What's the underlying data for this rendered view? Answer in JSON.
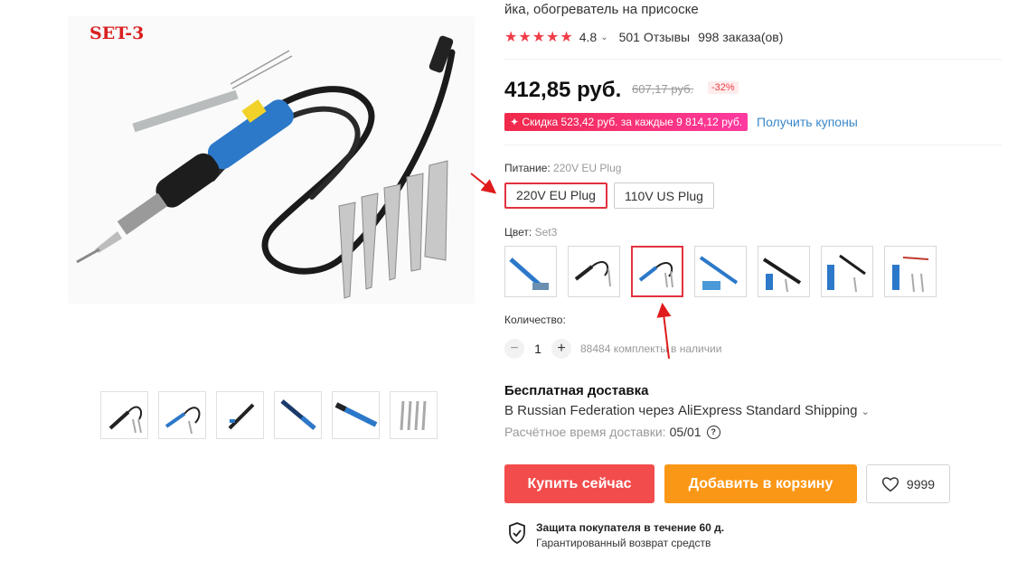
{
  "product": {
    "title_tail": "йка, обогреватель на присоске",
    "rating": "4.8",
    "reviews": "501 Отзывы",
    "orders": "998 заказа(ов)",
    "image_label": "SET-3",
    "thumbnail_count": 6
  },
  "price": {
    "current": "412,85 руб.",
    "old": "607,17 руб.",
    "discount": "-32%",
    "coupon_badge": "✦ Скидка 523,42 руб. за каждые 9 814,12 руб.",
    "coupon_link": "Получить купоны"
  },
  "options": {
    "power_label": "Питание:",
    "power_value": "220V EU Plug",
    "power_choices": [
      "220V EU Plug",
      "110V US Plug"
    ],
    "color_label": "Цвет:",
    "color_value": "Set3",
    "color_swatch_count": 7,
    "color_selected_index": 2
  },
  "quantity": {
    "label": "Количество:",
    "minus": "−",
    "value": "1",
    "plus": "+",
    "stock": "88484 комплекты в наличии"
  },
  "shipping": {
    "title": "Бесплатная доставка",
    "via": "В Russian Federation через AliExpress Standard Shipping",
    "time_label": "Расчётное время доставки:",
    "time_value": "05/01",
    "help": "?"
  },
  "actions": {
    "buy": "Купить сейчас",
    "cart": "Добавить в корзину",
    "wish_count": "9999"
  },
  "protection": {
    "title": "Защита покупателя в течение 60 д.",
    "subtitle": "Гарантированный возврат средств"
  },
  "colors": {
    "accent_red": "#f34c4c",
    "accent_orange": "#fb9717",
    "link_blue": "#3a87c9",
    "selected_border": "#e3323f"
  }
}
